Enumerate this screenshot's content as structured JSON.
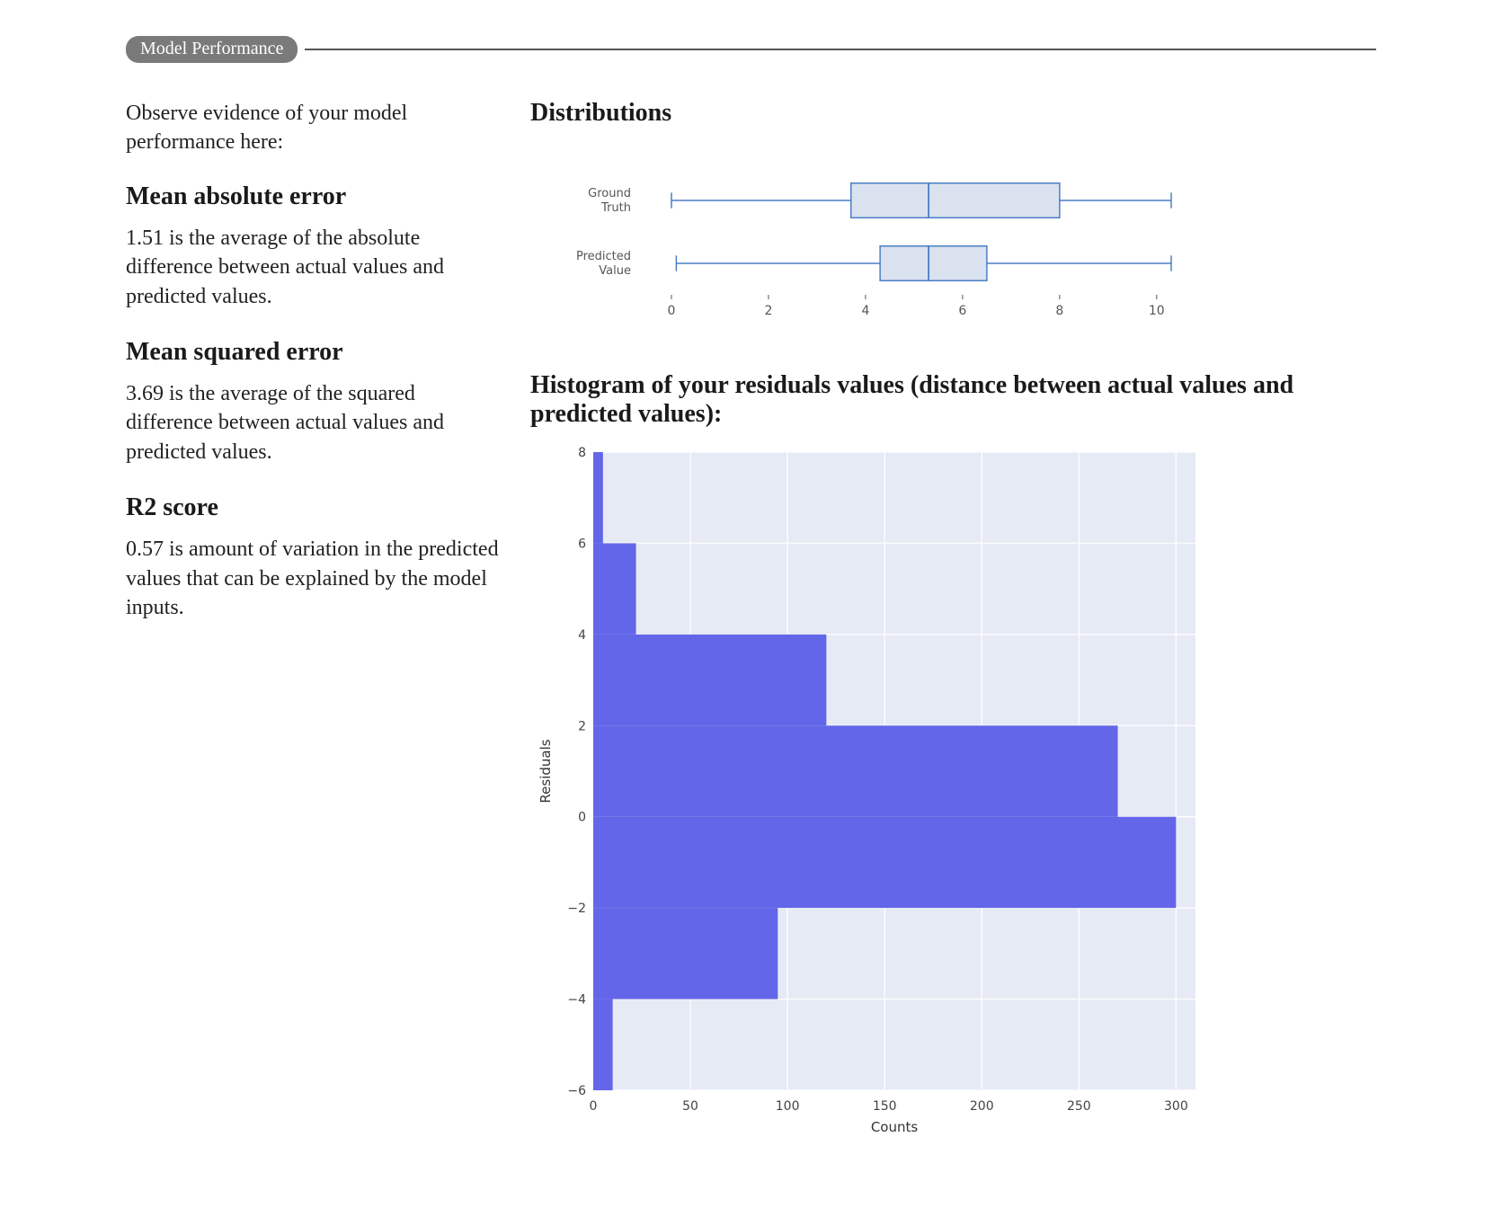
{
  "section_title": "Model Performance",
  "intro": "Observe evidence of your model performance here:",
  "metrics": {
    "mae": {
      "title": "Mean absolute error",
      "desc": "1.51 is the average of the absolute difference between actual values and predicted values."
    },
    "mse": {
      "title": "Mean squared error",
      "desc": "3.69 is the average of the squared difference between actual values and predicted values."
    },
    "r2": {
      "title": "R2 score",
      "desc": "0.57 is amount of variation in the predicted values that can be explained by the model inputs."
    }
  },
  "distributions_title": "Distributions",
  "histogram_title": "Histogram of your residuals values (distance between actual values and predicted values):",
  "chart_data": [
    {
      "type": "boxplot",
      "title": "Distributions",
      "categories": [
        "Ground Truth",
        "Predicted Value"
      ],
      "series": [
        {
          "name": "Ground Truth",
          "whisker_low": 0.0,
          "q1": 3.7,
          "median": 5.3,
          "q3": 8.0,
          "whisker_high": 10.3
        },
        {
          "name": "Predicted Value",
          "whisker_low": 0.1,
          "q1": 4.3,
          "median": 5.3,
          "q3": 6.5,
          "whisker_high": 10.3
        }
      ],
      "x_ticks": [
        0,
        2,
        4,
        6,
        8,
        10
      ],
      "xlim": [
        -0.5,
        10.8
      ]
    },
    {
      "type": "bar",
      "orientation": "horizontal",
      "title": "Histogram of your residuals values (distance between actual values and predicted values):",
      "xlabel": "Counts",
      "ylabel": "Residuals",
      "xlim": [
        0,
        310
      ],
      "ylim": [
        -6,
        8
      ],
      "x_ticks": [
        0,
        50,
        100,
        150,
        200,
        250,
        300
      ],
      "y_ticks": [
        -6,
        -4,
        -2,
        0,
        2,
        4,
        6,
        8
      ],
      "bars": [
        {
          "y_low": -6,
          "y_high": -4,
          "count": 10
        },
        {
          "y_low": -4,
          "y_high": -2,
          "count": 95
        },
        {
          "y_low": -2,
          "y_high": 0,
          "count": 300
        },
        {
          "y_low": 0,
          "y_high": 2,
          "count": 270
        },
        {
          "y_low": 2,
          "y_high": 4,
          "count": 120
        },
        {
          "y_low": 4,
          "y_high": 6,
          "count": 22
        },
        {
          "y_low": 6,
          "y_high": 8,
          "count": 5
        }
      ]
    }
  ]
}
